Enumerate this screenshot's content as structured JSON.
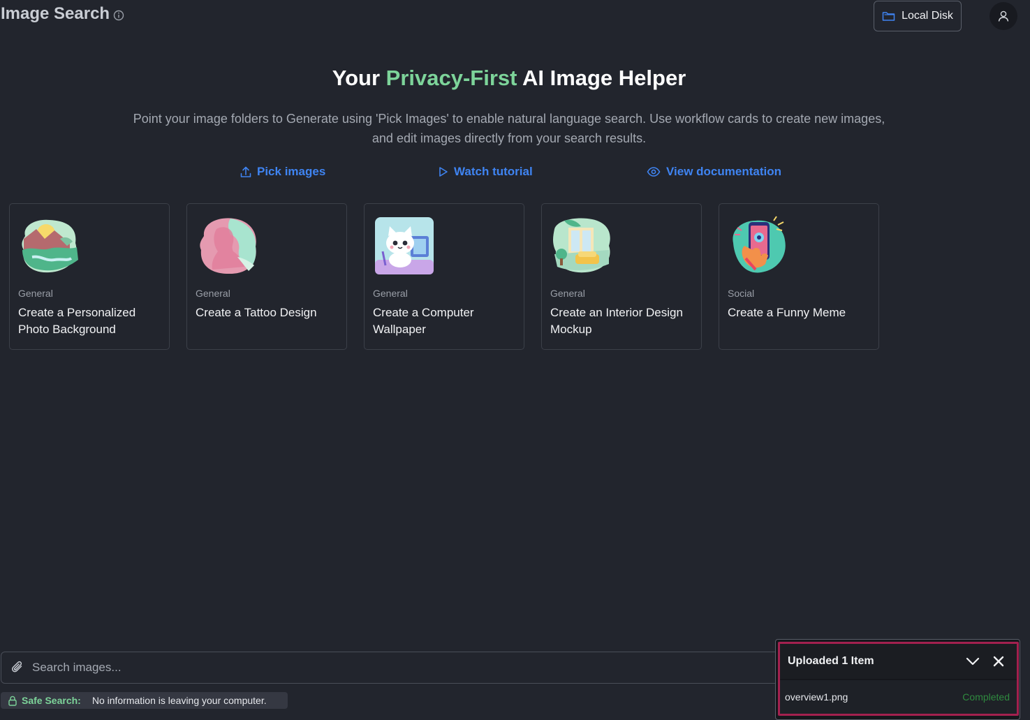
{
  "header": {
    "title": "Image Search",
    "info_icon": "info-circle-icon",
    "location_button": "Local Disk",
    "location_icon": "folder-icon",
    "avatar_icon": "user-icon"
  },
  "hero": {
    "title_prefix": "Your ",
    "title_accent": "Privacy-First",
    "title_suffix": " AI Image Helper",
    "accent_color": "#7dd49a",
    "description": "Point your image folders to Generate using 'Pick Images' to enable natural language search. Use workflow cards to create new images, and edit images directly from your search results."
  },
  "links": [
    {
      "label": "Pick images",
      "icon": "upload-icon"
    },
    {
      "label": "Watch tutorial",
      "icon": "play-icon"
    },
    {
      "label": "View documentation",
      "icon": "eye-icon"
    }
  ],
  "cards": [
    {
      "category": "General",
      "title": "Create a Personalized Photo Background",
      "thumb": "landscape-illustration"
    },
    {
      "category": "General",
      "title": "Create a Tattoo Design",
      "thumb": "silhouette-illustration"
    },
    {
      "category": "General",
      "title": "Create a Computer Wallpaper",
      "thumb": "cat-illustration"
    },
    {
      "category": "General",
      "title": "Create an Interior Design Mockup",
      "thumb": "room-illustration"
    },
    {
      "category": "Social",
      "title": "Create a Funny Meme",
      "thumb": "phone-illustration"
    }
  ],
  "search": {
    "placeholder": "Search images...",
    "attach_icon": "paperclip-icon"
  },
  "safe_search": {
    "label": "Safe Search:",
    "text": "No information is leaving your computer.",
    "icon": "lock-icon"
  },
  "upload": {
    "title": "Uploaded 1 Item",
    "file_name": "overview1.png",
    "status": "Completed",
    "status_color": "#2f8a3f",
    "highlight_color": "#a3214f"
  }
}
